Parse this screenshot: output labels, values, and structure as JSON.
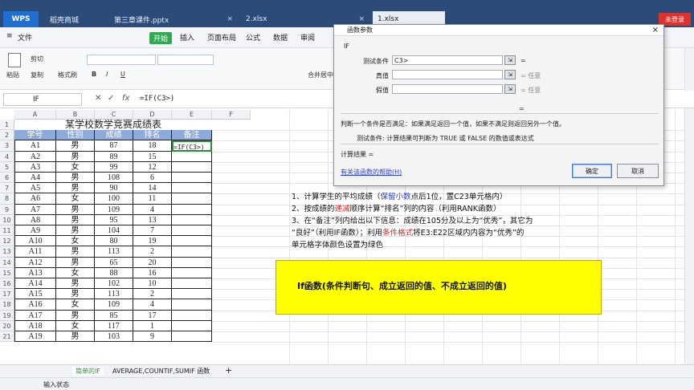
{
  "titlebar": {
    "wps": "WPS",
    "tabs": [
      {
        "label": "稻壳商城"
      },
      {
        "label": "第三章课件.pptx"
      },
      {
        "label": "2.xlsx"
      },
      {
        "label": "1.xlsx"
      }
    ],
    "login": "未登录"
  },
  "menu": {
    "file": "文件",
    "start": "开始",
    "items": [
      "插入",
      "页面布局",
      "公式",
      "数据",
      "审阅"
    ]
  },
  "toolbar": {
    "paste": "粘贴",
    "cut": "剪切",
    "copy": "复制",
    "format": "格式刷",
    "merge": "合并居中",
    "font_b": "B",
    "font_i": "I",
    "font_u": "U"
  },
  "formula_bar": {
    "name_box": "IF",
    "formula": "=IF(C3>)"
  },
  "columns": [
    "A",
    "B",
    "C",
    "D",
    "E",
    "F"
  ],
  "sheet": {
    "title": "某学校数学竞赛成绩表",
    "headers": [
      "学号",
      "性别",
      "成绩",
      "排名",
      "备注"
    ],
    "rows": [
      [
        "A1",
        "男",
        "87",
        "18",
        "=IF(C3>)"
      ],
      [
        "A2",
        "男",
        "89",
        "15",
        ""
      ],
      [
        "A3",
        "女",
        "99",
        "12",
        ""
      ],
      [
        "A4",
        "男",
        "108",
        "6",
        ""
      ],
      [
        "A5",
        "男",
        "90",
        "14",
        ""
      ],
      [
        "A6",
        "女",
        "100",
        "11",
        ""
      ],
      [
        "A7",
        "男",
        "109",
        "4",
        ""
      ],
      [
        "A8",
        "男",
        "95",
        "13",
        ""
      ],
      [
        "A9",
        "男",
        "104",
        "7",
        ""
      ],
      [
        "A10",
        "女",
        "80",
        "19",
        ""
      ],
      [
        "A11",
        "男",
        "113",
        "2",
        ""
      ],
      [
        "A12",
        "男",
        "65",
        "20",
        ""
      ],
      [
        "A13",
        "女",
        "88",
        "16",
        ""
      ],
      [
        "A14",
        "男",
        "102",
        "10",
        ""
      ],
      [
        "A15",
        "男",
        "113",
        "2",
        ""
      ],
      [
        "A16",
        "女",
        "109",
        "4",
        ""
      ],
      [
        "A17",
        "男",
        "85",
        "17",
        ""
      ],
      [
        "A18",
        "女",
        "117",
        "1",
        ""
      ],
      [
        "A19",
        "男",
        "103",
        "9",
        ""
      ]
    ],
    "row_numbers": [
      "1",
      "2",
      "3",
      "4",
      "5",
      "6",
      "7",
      "8",
      "9",
      "10",
      "11",
      "12",
      "13",
      "14",
      "15",
      "16",
      "17",
      "18",
      "19",
      "20",
      "21"
    ]
  },
  "dialog": {
    "title": "函数参数",
    "func": "IF",
    "label_test": "测试条件",
    "value_test": "C3>",
    "label_true": "真值",
    "label_false": "假值",
    "eq": "=",
    "any": "= 任意",
    "desc": "判断一个条件是否满足：如果满足返回一个值，如果不满足则返回另外一个值。",
    "desc2": "测试条件:  计算结果可判断为 TRUE 或 FALSE 的数值或表达式",
    "result_label": "计算结果  =",
    "help": "有关该函数的帮助(H)",
    "ok": "确定",
    "cancel": "取消"
  },
  "notes": {
    "line1a": "1、计算学生的平均成绩（",
    "line1b": "保留小数",
    "line1c": "点后1位，置C23单元格内）",
    "line2a": "2、按成绩的",
    "line2b": "递减",
    "line2c": "顺序计算“排名”列的内容（利用RANK函数）",
    "line3": "3、在“备注”列内给出以下信息：成绩在105分及以上为“优秀”，其它为",
    "line4a": "“良好”（利用IF函数）；利用",
    "line4b": "条件格式",
    "line4c": "将E3:E22区域内内容为“优秀”的",
    "line5": "单元格字体颜色设置为绿色"
  },
  "banner": "If函数(条件判断句、成立返回的值、不成立返回的值)",
  "sheet_tabs": [
    "简单的IF",
    "AVERAGE,COUNTIF,SUMIF 函数"
  ],
  "status": "输入状态",
  "colors": {
    "accent": "#33a853",
    "header_fill": "#8eaadb",
    "banner": "#ffff00"
  }
}
